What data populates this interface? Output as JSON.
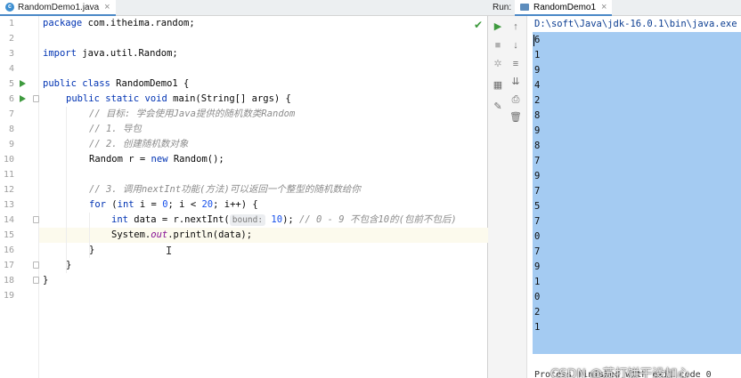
{
  "editor": {
    "tab_label": "RandomDemo1.java",
    "line_numbers": [
      "1",
      "2",
      "3",
      "4",
      "5",
      "6",
      "7",
      "8",
      "9",
      "10",
      "11",
      "12",
      "13",
      "14",
      "15",
      "16",
      "17",
      "18",
      "19"
    ],
    "inlay_hint": "bound:",
    "lines": {
      "l1_kw": "package",
      "l1_rest": " com.itheima.random;",
      "l3_kw": "import",
      "l3_rest": " java.util.Random;",
      "l5_kw": "public class",
      "l5_rest": " RandomDemo1 {",
      "l6_kw": "public static void",
      "l6_rest": " main(String[] args) {",
      "l7_comment": "// 目标: 学会使用Java提供的随机数类Random",
      "l8_comment": "// 1. 导包",
      "l9_comment": "// 2. 创建随机数对象",
      "l10_a": "Random r = ",
      "l10_kw": "new",
      "l10_b": " Random();",
      "l12_comment": "// 3. 调用nextInt功能(方法)可以返回一个整型的随机数给你",
      "l13_kw": "for",
      "l13_a": " (",
      "l13_kw2": "int",
      "l13_b": " i = ",
      "l13_n0": "0",
      "l13_c": "; i < ",
      "l13_n20": "20",
      "l13_d": "; i++) {",
      "l14_kw": "int",
      "l14_a": " data = r.nextInt(",
      "l14_n10": "10",
      "l14_b": "); ",
      "l14_comment": "// 0 - 9 不包含10的(包前不包后)",
      "l15_a": "System.",
      "l15_fld": "out",
      "l15_b": ".println(data);",
      "l16": "}",
      "l17": "}",
      "l18": "}"
    }
  },
  "run_window": {
    "title": "Run:",
    "tab_label": "RandomDemo1",
    "command": "D:\\soft\\Java\\jdk-16.0.1\\bin\\java.exe",
    "output": [
      "6",
      "1",
      "9",
      "4",
      "2",
      "8",
      "9",
      "8",
      "7",
      "9",
      "7",
      "5",
      "7",
      "0",
      "7",
      "9",
      "1",
      "0",
      "2",
      "1"
    ],
    "process_line": "Process finished with exit code 0",
    "watermark": "CSDN @苏打饼干没加心"
  },
  "colors": {
    "keyword": "#0033b3",
    "comment": "#8c8c8c",
    "number": "#1750eb",
    "selection": "#a4cbf2",
    "run_icon": "#3e9a3e"
  },
  "icons": [
    "run-icon",
    "stop-icon",
    "rerun-icon",
    "layout-icon",
    "pin-icon",
    "up-arrow-icon",
    "down-arrow-icon",
    "soft-wrap-icon",
    "scroll-end-icon",
    "print-icon",
    "trash-icon",
    "check-icon",
    "java-class-icon"
  ]
}
